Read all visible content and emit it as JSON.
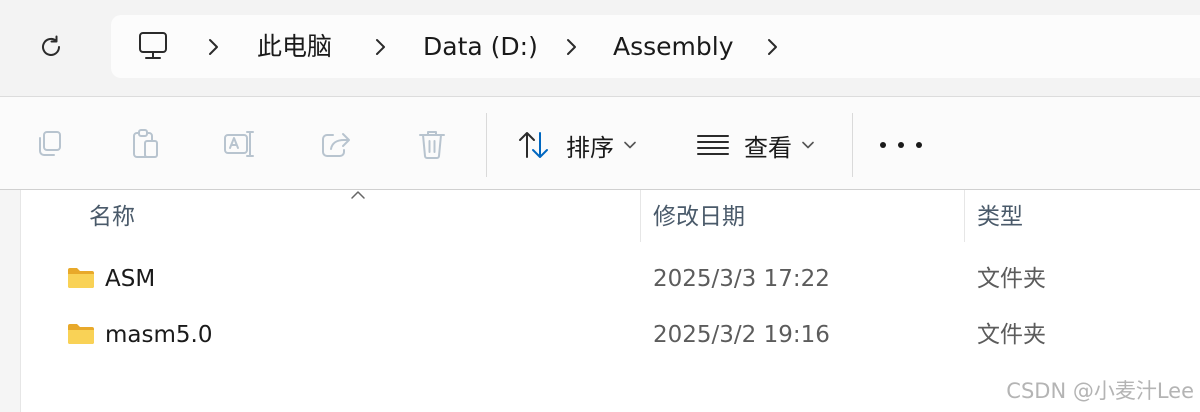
{
  "breadcrumb": {
    "items": [
      "此电脑",
      "Data (D:)",
      "Assembly"
    ]
  },
  "toolbar": {
    "sort_label": "排序",
    "view_label": "查看"
  },
  "columns": {
    "name": "名称",
    "date": "修改日期",
    "type": "类型"
  },
  "files": [
    {
      "name": "ASM",
      "modified": "2025/3/3 17:22",
      "type": "文件夹"
    },
    {
      "name": "masm5.0",
      "modified": "2025/3/2 19:16",
      "type": "文件夹"
    }
  ],
  "watermark": "CSDN @小麦汁Lee",
  "colors": {
    "folder": "#f4c542",
    "accent": "#0067c0"
  }
}
